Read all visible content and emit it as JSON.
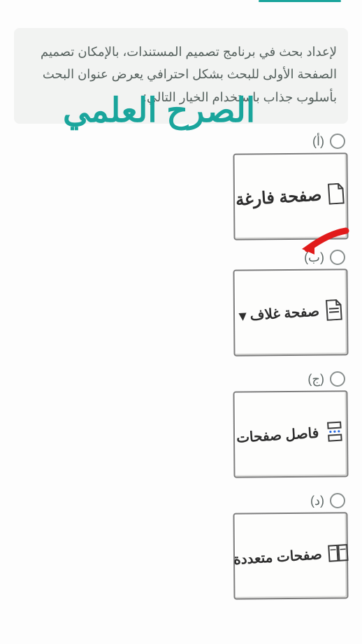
{
  "watermark_text": "الصرح العلمي",
  "question_text": "لإعداد بحث في برنامج تصميم المستندات، بالإمكان تصميم الصفحة الأولى للبحث بشكل احترافي يعرض عنوان البحث بأسلوب جذاب باستخدام الخيار التالي:",
  "options": [
    {
      "key": "a",
      "label": "(أ)",
      "tile_text": "صفحة فارغة",
      "icon": "page-blank-icon",
      "highlighted": false
    },
    {
      "key": "b",
      "label": "(ب)",
      "tile_text": "صفحة غلاف ▾",
      "icon": "page-cover-icon",
      "highlighted": true
    },
    {
      "key": "c",
      "label": "(ج)",
      "tile_text": "فاصل صفحات",
      "icon": "page-break-icon",
      "highlighted": false
    },
    {
      "key": "d",
      "label": "(د)",
      "tile_text": "صفحات متعددة",
      "icon": "multi-page-icon",
      "highlighted": false
    }
  ]
}
